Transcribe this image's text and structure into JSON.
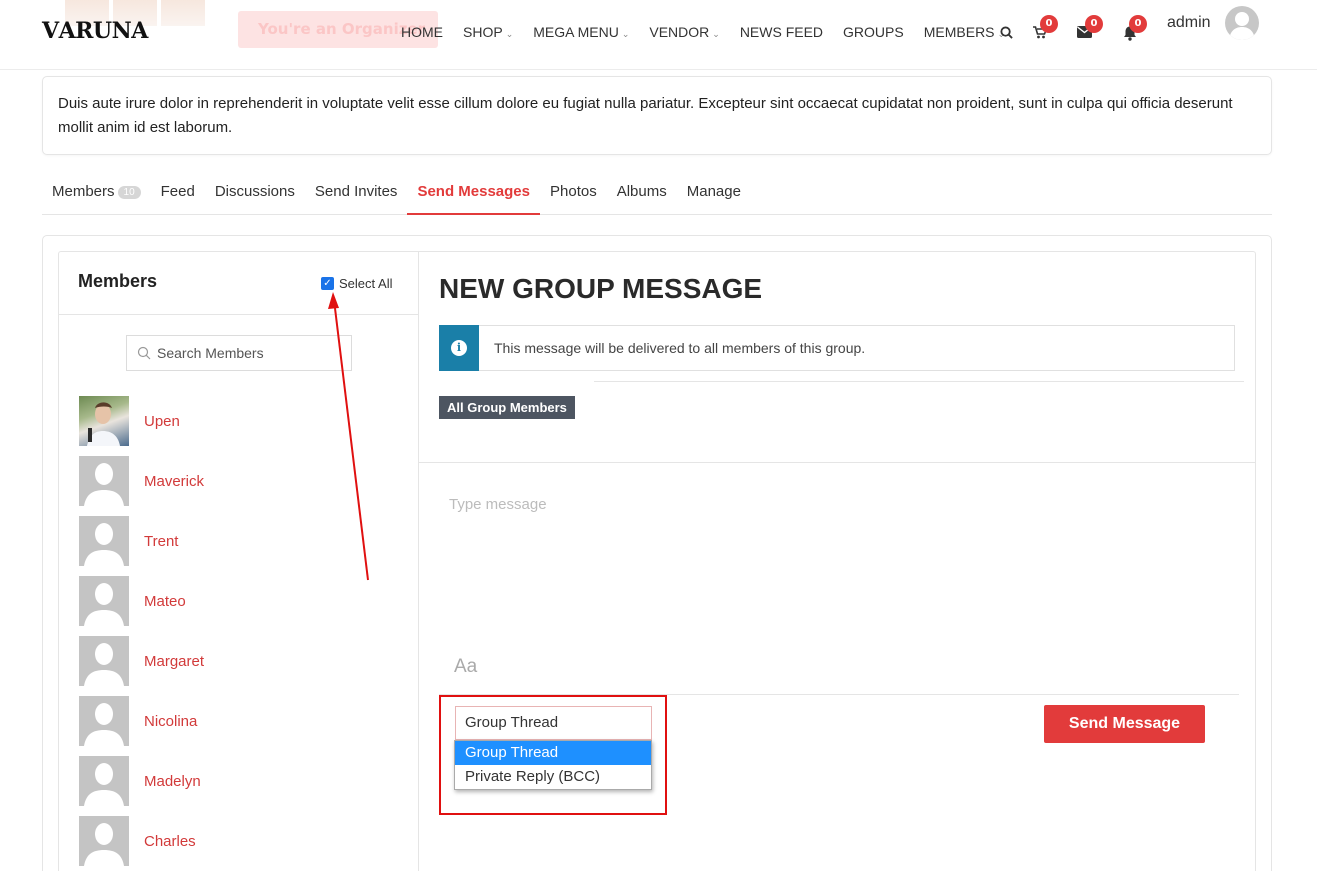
{
  "header": {
    "logo_text": "ARUNA",
    "logo_initial": "V",
    "organizer_label": "You're an Organizer",
    "nav": [
      {
        "label": "HOME",
        "caret": false
      },
      {
        "label": "SHOP",
        "caret": true
      },
      {
        "label": "MEGA MENU",
        "caret": true
      },
      {
        "label": "VENDOR",
        "caret": true
      },
      {
        "label": "NEWS FEED",
        "caret": false
      },
      {
        "label": "GROUPS",
        "caret": false
      },
      {
        "label": "MEMBERS",
        "caret": true
      }
    ],
    "cart_count": "0",
    "messages_count": "0",
    "notifications_count": "0",
    "user_name": "admin"
  },
  "group": {
    "description": "Duis aute irure dolor in reprehenderit in voluptate velit esse cillum dolore eu fugiat nulla pariatur. Excepteur sint occaecat cupidatat non proident, sunt in culpa qui officia deserunt mollit anim id est laborum."
  },
  "tabs": [
    {
      "label": "Members",
      "count": "10"
    },
    {
      "label": "Feed"
    },
    {
      "label": "Discussions"
    },
    {
      "label": "Send Invites"
    },
    {
      "label": "Send Messages",
      "active": true
    },
    {
      "label": "Photos"
    },
    {
      "label": "Albums"
    },
    {
      "label": "Manage"
    }
  ],
  "sidebar": {
    "title": "Members",
    "select_all_label": "Select All",
    "select_all_checked": true,
    "search_placeholder": "Search Members",
    "members": [
      {
        "name": "Upen",
        "has_photo": true
      },
      {
        "name": "Maverick"
      },
      {
        "name": "Trent"
      },
      {
        "name": "Mateo"
      },
      {
        "name": "Margaret"
      },
      {
        "name": "Nicolina"
      },
      {
        "name": "Madelyn"
      },
      {
        "name": "Charles"
      }
    ]
  },
  "message": {
    "title": "NEW GROUP MESSAGE",
    "info_text": "This message will be delivered to all members of this group.",
    "recipient_tag": "All Group Members",
    "message_placeholder": "Type message",
    "format_label": "Aa",
    "thread_type_selected": "Group Thread",
    "thread_type_options": [
      "Group Thread",
      "Private Reply (BCC)"
    ],
    "send_label": "Send Message"
  },
  "colors": {
    "accent": "#e23b3b",
    "info": "#1a7fa8",
    "annotation": "#e01010"
  }
}
